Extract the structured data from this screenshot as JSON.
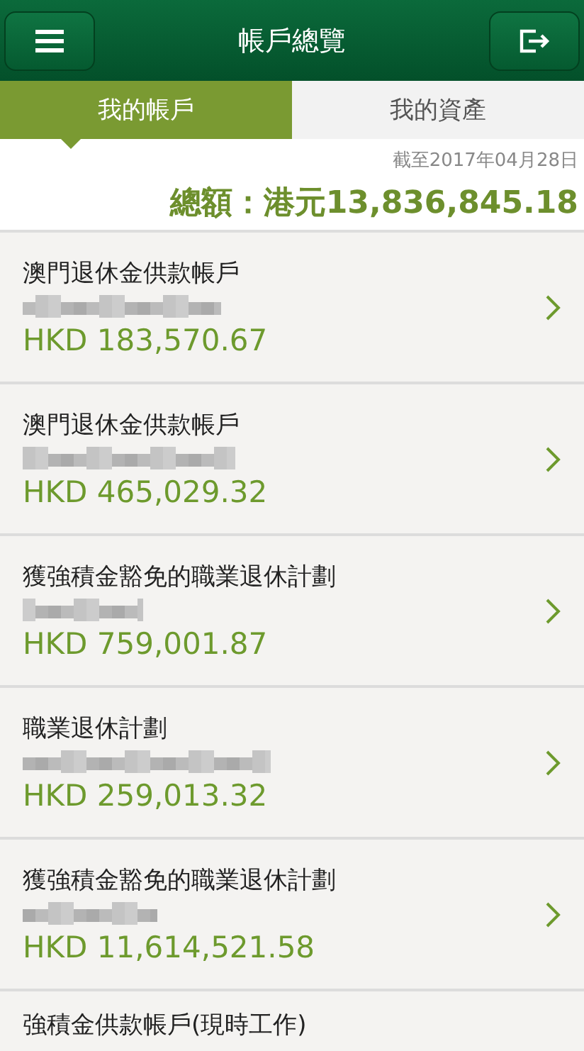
{
  "header": {
    "title": "帳戶總覽"
  },
  "tabs": [
    {
      "label": "我的帳戶",
      "selected": true
    },
    {
      "label": "我的資產",
      "selected": false
    }
  ],
  "summary": {
    "as_of": "截至2017年04月28日",
    "total_label": "總額：",
    "total_currency": "港元",
    "total_amount": "13,836,845.18"
  },
  "accounts": [
    {
      "name": "澳門退休金供款帳戶",
      "amount": "HKD 183,570.67"
    },
    {
      "name": "澳門退休金供款帳戶",
      "amount": "HKD 465,029.32"
    },
    {
      "name": "獲強積金豁免的職業退休計劃",
      "amount": "HKD 759,001.87"
    },
    {
      "name": "職業退休計劃",
      "amount": "HKD 259,013.32"
    },
    {
      "name": "獲強積金豁免的職業退休計劃",
      "amount": "HKD 11,614,521.58"
    },
    {
      "name": "強積金供款帳戶(現時工作)"
    }
  ]
}
